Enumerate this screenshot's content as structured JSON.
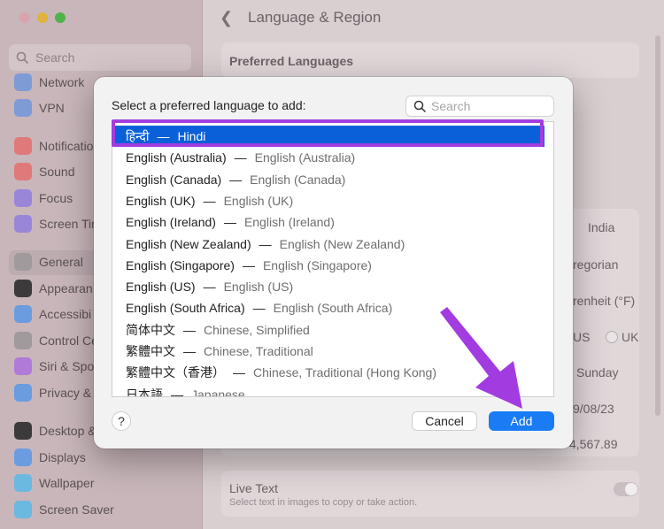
{
  "window": {
    "title": "Language & Region",
    "sidebar_search_placeholder": "Search",
    "sidebar_items": [
      {
        "label": "Network",
        "icon": "globe-icon",
        "color": "#7f9bd6"
      },
      {
        "label": "VPN",
        "icon": "globe-icon",
        "color": "#7f9bd6"
      },
      {
        "label": "Notificatio",
        "icon": "bell-icon",
        "color": "#e07a7a"
      },
      {
        "label": "Sound",
        "icon": "speaker-icon",
        "color": "#e07a7a"
      },
      {
        "label": "Focus",
        "icon": "moon-icon",
        "color": "#9a86d8"
      },
      {
        "label": "Screen Tim",
        "icon": "hourglass-icon",
        "color": "#9a86d8"
      },
      {
        "label": "General",
        "icon": "gear-icon",
        "color": "#a09a9c"
      },
      {
        "label": "Appearan",
        "icon": "appearance-icon",
        "color": "#3d3a3b"
      },
      {
        "label": "Accessibi",
        "icon": "accessibility-icon",
        "color": "#6b9ce0"
      },
      {
        "label": "Control Ce",
        "icon": "control-center-icon",
        "color": "#a09a9c"
      },
      {
        "label": "Siri & Spo",
        "icon": "siri-icon",
        "color": "#b07ad8"
      },
      {
        "label": "Privacy &",
        "icon": "hand-icon",
        "color": "#6b9ce0"
      },
      {
        "label": "Desktop &",
        "icon": "desktop-icon",
        "color": "#3d3a3b"
      },
      {
        "label": "Displays",
        "icon": "displays-icon",
        "color": "#6b9ce0"
      },
      {
        "label": "Wallpaper",
        "icon": "wallpaper-icon",
        "color": "#6bb8e0"
      },
      {
        "label": "Screen Saver",
        "icon": "screensaver-icon",
        "color": "#6bb8e0"
      }
    ],
    "preferred_languages_heading": "Preferred Languages",
    "region_value": "India",
    "calendar_value": "regorian",
    "temperature_value": "renheit (°F)",
    "measurement_us": "US",
    "measurement_uk": "UK",
    "first_day_value": "Sunday",
    "date_format_value": "9/08/23",
    "number_format_value": "4,567.89",
    "live_text_label": "Live Text",
    "live_text_sub": "Select text in images to copy or take action."
  },
  "dialog": {
    "prompt": "Select a preferred language to add:",
    "search_placeholder": "Search",
    "languages": [
      {
        "native": "हिन्दी",
        "english": "Hindi",
        "selected": true
      },
      {
        "native": "English (Australia)",
        "english": "English (Australia)"
      },
      {
        "native": "English (Canada)",
        "english": "English (Canada)"
      },
      {
        "native": "English (UK)",
        "english": "English (UK)"
      },
      {
        "native": "English (Ireland)",
        "english": "English (Ireland)"
      },
      {
        "native": "English (New Zealand)",
        "english": "English (New Zealand)"
      },
      {
        "native": "English (Singapore)",
        "english": "English (Singapore)"
      },
      {
        "native": "English (US)",
        "english": "English (US)"
      },
      {
        "native": "English (South Africa)",
        "english": "English (South Africa)"
      },
      {
        "native": "简体中文",
        "english": "Chinese, Simplified"
      },
      {
        "native": "繁體中文",
        "english": "Chinese, Traditional"
      },
      {
        "native": "繁體中文（香港）",
        "english": "Chinese, Traditional (Hong Kong)"
      },
      {
        "native": "日本語",
        "english": "Japanese"
      }
    ],
    "separator": "—",
    "help_label": "?",
    "cancel_label": "Cancel",
    "add_label": "Add"
  },
  "colors": {
    "selection": "#0a60d8",
    "accent_button": "#1a7cf5",
    "annotation": "#a23ce0"
  }
}
